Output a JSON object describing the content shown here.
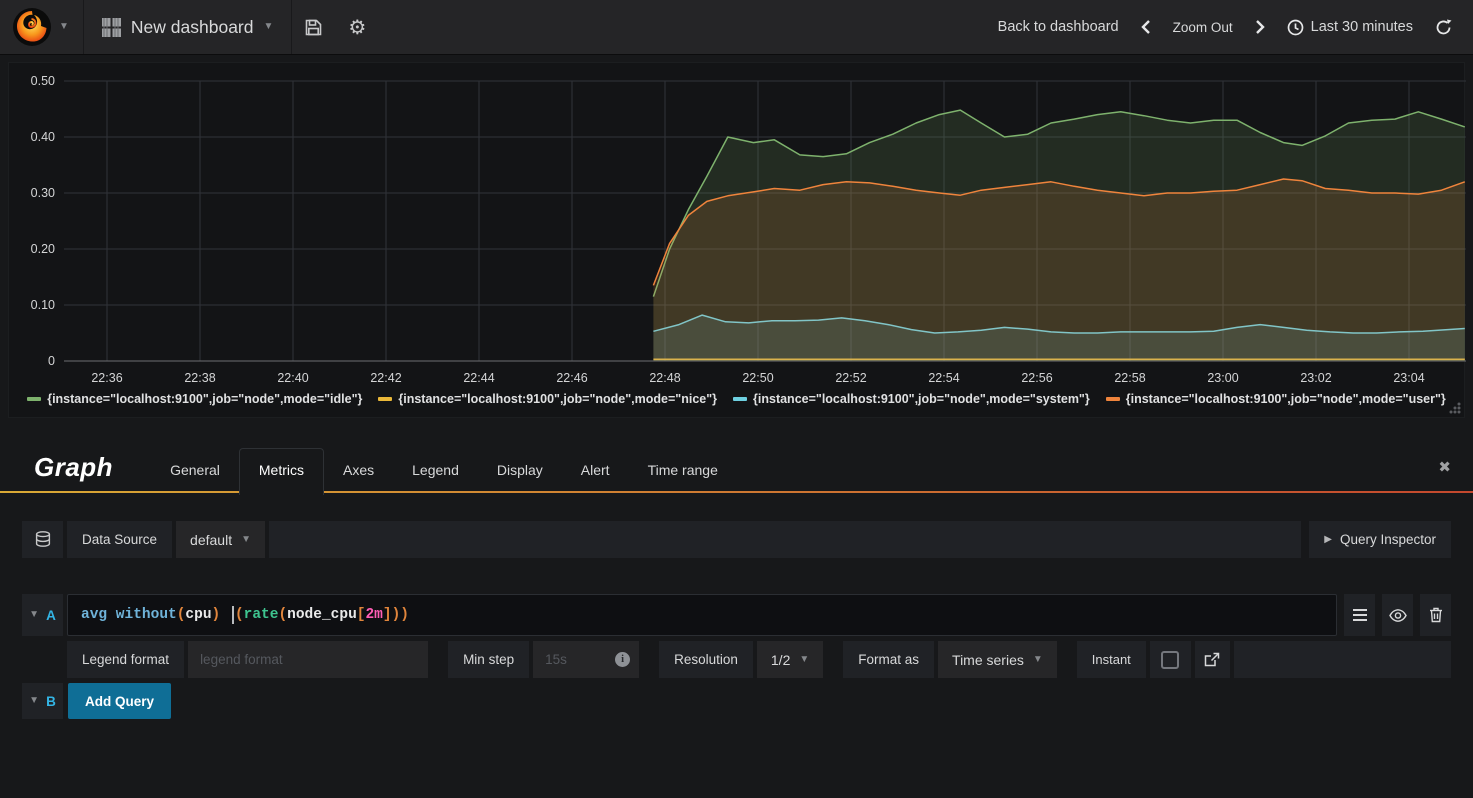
{
  "navbar": {
    "dashboard_title": "New dashboard",
    "back_to_dashboard": "Back to dashboard",
    "zoom_out": "Zoom Out",
    "time_range": "Last 30 minutes"
  },
  "chart_data": {
    "type": "area",
    "title": "",
    "xlabel": "",
    "ylabel": "",
    "ylim": [
      0,
      0.5
    ],
    "grid": true,
    "legend_position": "bottom",
    "y_ticks": [
      {
        "value": 0.5,
        "label": "0.50"
      },
      {
        "value": 0.4,
        "label": "0.40"
      },
      {
        "value": 0.3,
        "label": "0.30"
      },
      {
        "value": 0.2,
        "label": "0.20"
      },
      {
        "value": 0.1,
        "label": "0.10"
      },
      {
        "value": 0,
        "label": "0"
      }
    ],
    "x_ticks": [
      {
        "minute": 0,
        "label": "22:36"
      },
      {
        "minute": 2,
        "label": "22:38"
      },
      {
        "minute": 4,
        "label": "22:40"
      },
      {
        "minute": 6,
        "label": "22:42"
      },
      {
        "minute": 8,
        "label": "22:44"
      },
      {
        "minute": 10,
        "label": "22:46"
      },
      {
        "minute": 12,
        "label": "22:48"
      },
      {
        "minute": 14,
        "label": "22:50"
      },
      {
        "minute": 16,
        "label": "22:52"
      },
      {
        "minute": 18,
        "label": "22:54"
      },
      {
        "minute": 20,
        "label": "22:56"
      },
      {
        "minute": 22,
        "label": "22:58"
      },
      {
        "minute": 24,
        "label": "23:00"
      },
      {
        "minute": 26,
        "label": "23:02"
      },
      {
        "minute": 28,
        "label": "23:04"
      }
    ],
    "series": [
      {
        "name": "{instance=\"localhost:9100\",job=\"node\",mode=\"idle\"}",
        "color": "#7eb26d",
        "points": [
          [
            11.75,
            0.115
          ],
          [
            12.1,
            0.2
          ],
          [
            12.5,
            0.27
          ],
          [
            12.9,
            0.33
          ],
          [
            13.35,
            0.4
          ],
          [
            13.9,
            0.39
          ],
          [
            14.35,
            0.395
          ],
          [
            14.9,
            0.368
          ],
          [
            15.4,
            0.365
          ],
          [
            15.9,
            0.37
          ],
          [
            16.4,
            0.39
          ],
          [
            16.9,
            0.405
          ],
          [
            17.4,
            0.425
          ],
          [
            17.9,
            0.44
          ],
          [
            18.35,
            0.448
          ],
          [
            18.8,
            0.425
          ],
          [
            19.3,
            0.4
          ],
          [
            19.8,
            0.405
          ],
          [
            20.3,
            0.425
          ],
          [
            20.8,
            0.432
          ],
          [
            21.3,
            0.44
          ],
          [
            21.8,
            0.445
          ],
          [
            22.3,
            0.438
          ],
          [
            22.8,
            0.43
          ],
          [
            23.3,
            0.425
          ],
          [
            23.8,
            0.43
          ],
          [
            24.3,
            0.43
          ],
          [
            24.8,
            0.408
          ],
          [
            25.3,
            0.39
          ],
          [
            25.7,
            0.385
          ],
          [
            26.2,
            0.402
          ],
          [
            26.7,
            0.425
          ],
          [
            27.2,
            0.43
          ],
          [
            27.7,
            0.432
          ],
          [
            28.2,
            0.445
          ],
          [
            28.7,
            0.432
          ],
          [
            29.2,
            0.418
          ]
        ]
      },
      {
        "name": "{instance=\"localhost:9100\",job=\"node\",mode=\"nice\"}",
        "color": "#eab839",
        "points": [
          [
            11.75,
            0.003
          ],
          [
            29.2,
            0.003
          ]
        ]
      },
      {
        "name": "{instance=\"localhost:9100\",job=\"node\",mode=\"system\"}",
        "color": "#6ed0e0",
        "points": [
          [
            11.75,
            0.053
          ],
          [
            12.3,
            0.065
          ],
          [
            12.8,
            0.082
          ],
          [
            13.3,
            0.07
          ],
          [
            13.8,
            0.068
          ],
          [
            14.3,
            0.072
          ],
          [
            14.8,
            0.072
          ],
          [
            15.3,
            0.073
          ],
          [
            15.8,
            0.077
          ],
          [
            16.3,
            0.072
          ],
          [
            16.8,
            0.065
          ],
          [
            17.3,
            0.056
          ],
          [
            17.8,
            0.05
          ],
          [
            18.3,
            0.052
          ],
          [
            18.8,
            0.055
          ],
          [
            19.3,
            0.06
          ],
          [
            19.8,
            0.057
          ],
          [
            20.3,
            0.052
          ],
          [
            20.8,
            0.05
          ],
          [
            21.3,
            0.05
          ],
          [
            21.8,
            0.052
          ],
          [
            22.3,
            0.052
          ],
          [
            22.8,
            0.052
          ],
          [
            23.3,
            0.052
          ],
          [
            23.8,
            0.053
          ],
          [
            24.3,
            0.06
          ],
          [
            24.8,
            0.065
          ],
          [
            25.3,
            0.06
          ],
          [
            25.8,
            0.055
          ],
          [
            26.3,
            0.052
          ],
          [
            26.8,
            0.05
          ],
          [
            27.3,
            0.05
          ],
          [
            27.8,
            0.052
          ],
          [
            28.3,
            0.053
          ],
          [
            29.2,
            0.058
          ]
        ]
      },
      {
        "name": "{instance=\"localhost:9100\",job=\"node\",mode=\"user\"}",
        "color": "#ef843c",
        "points": [
          [
            11.75,
            0.135
          ],
          [
            12.1,
            0.21
          ],
          [
            12.5,
            0.26
          ],
          [
            12.9,
            0.285
          ],
          [
            13.35,
            0.295
          ],
          [
            13.9,
            0.302
          ],
          [
            14.35,
            0.308
          ],
          [
            14.9,
            0.305
          ],
          [
            15.4,
            0.315
          ],
          [
            15.9,
            0.32
          ],
          [
            16.4,
            0.318
          ],
          [
            16.9,
            0.312
          ],
          [
            17.4,
            0.305
          ],
          [
            17.9,
            0.3
          ],
          [
            18.35,
            0.296
          ],
          [
            18.8,
            0.305
          ],
          [
            19.3,
            0.31
          ],
          [
            19.8,
            0.315
          ],
          [
            20.3,
            0.32
          ],
          [
            20.8,
            0.312
          ],
          [
            21.3,
            0.305
          ],
          [
            21.8,
            0.3
          ],
          [
            22.3,
            0.295
          ],
          [
            22.8,
            0.3
          ],
          [
            23.3,
            0.3
          ],
          [
            23.8,
            0.303
          ],
          [
            24.3,
            0.305
          ],
          [
            24.8,
            0.315
          ],
          [
            25.3,
            0.325
          ],
          [
            25.7,
            0.322
          ],
          [
            26.2,
            0.308
          ],
          [
            26.7,
            0.305
          ],
          [
            27.2,
            0.3
          ],
          [
            27.7,
            0.3
          ],
          [
            28.2,
            0.298
          ],
          [
            28.7,
            0.305
          ],
          [
            29.2,
            0.32
          ]
        ]
      }
    ]
  },
  "editor": {
    "panel_title": "Graph",
    "tabs": [
      "General",
      "Metrics",
      "Axes",
      "Legend",
      "Display",
      "Alert",
      "Time range"
    ],
    "active_tab": "Metrics",
    "datasource_row": {
      "label": "Data Source",
      "value": "default",
      "query_inspector": "Query Inspector"
    },
    "query_a": {
      "ref": "A",
      "query_text": "avg without(cpu) (rate(node_cpu[2m]))",
      "tokens": [
        {
          "text": "avg without",
          "type": "keyword"
        },
        {
          "text": "(",
          "type": "paren"
        },
        {
          "text": "cpu",
          "type": "plain"
        },
        {
          "text": ") ",
          "type": "paren"
        },
        {
          "text": "",
          "type": "cursor"
        },
        {
          "text": "(",
          "type": "paren"
        },
        {
          "text": "rate",
          "type": "func"
        },
        {
          "text": "(",
          "type": "paren"
        },
        {
          "text": "node_cpu",
          "type": "plain"
        },
        {
          "text": "[",
          "type": "paren"
        },
        {
          "text": "2m",
          "type": "duration"
        },
        {
          "text": "]",
          "type": "paren"
        },
        {
          "text": "))",
          "type": "paren"
        }
      ]
    },
    "options": {
      "legend_format_label": "Legend format",
      "legend_format_placeholder": "legend format",
      "min_step_label": "Min step",
      "min_step_placeholder": "15s",
      "resolution_label": "Resolution",
      "resolution_value": "1/2",
      "format_as_label": "Format as",
      "format_as_value": "Time series",
      "instant_label": "Instant",
      "instant_checked": false
    },
    "query_b": {
      "ref": "B",
      "add_query_label": "Add Query"
    }
  },
  "colors": {
    "syntax": {
      "keyword": "#6fb3d9",
      "func": "#3ec48f",
      "paren": "#e0853c",
      "duration": "#ff5eb5",
      "plain": "#eaeaea",
      "cursor": "#b9bbbe"
    },
    "tab_underline_start": "#d9a935",
    "tab_underline_end": "#c4482e",
    "add_query_bg": "#0f6e96",
    "ref_letter": "#33b5e5"
  }
}
